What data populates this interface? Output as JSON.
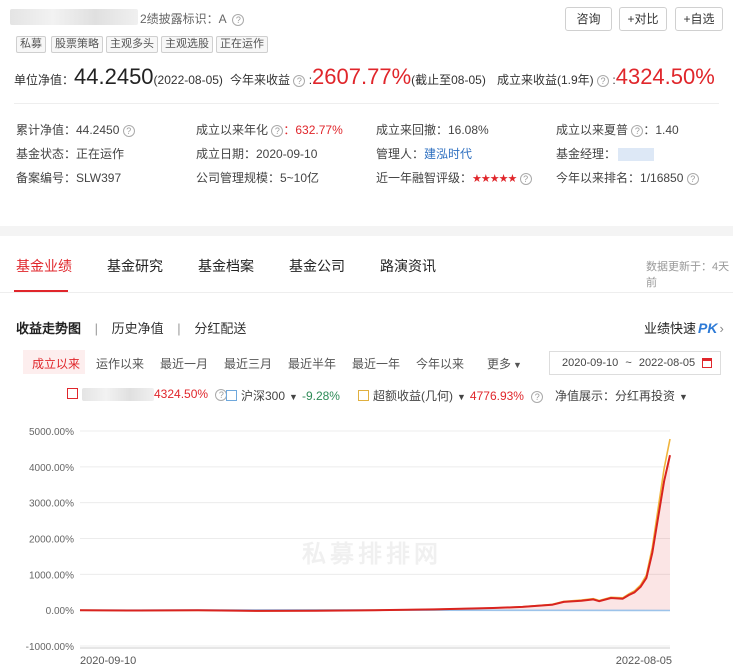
{
  "header": {
    "title_suffix": "2绩披露标识：A",
    "buttons": [
      "咨询",
      "+对比",
      "+自选"
    ],
    "tags": [
      "私募",
      "股票策略",
      "主观多头",
      "主观选股",
      "正在运作"
    ]
  },
  "summary": {
    "nav_label": "单位净值：",
    "nav_value": "44.2450",
    "nav_date": "(2022-08-05)",
    "ytd_label": "今年来收益",
    "ytd_value": "2607.77%",
    "ytd_note": "(截止至08-05)",
    "since_label": "成立来收益(1.9年)",
    "since_value": "4324.50%"
  },
  "info": {
    "cum_nav": "累计净值：44.2450",
    "annual_label": "成立以来年化",
    "annual_value": "：632.77%",
    "drawdown": "成立来回撤：16.08%",
    "sharpe_label": "成立以来夏普",
    "sharpe_value": "：1.40",
    "status": "基金状态：正在运作",
    "inception": "成立日期：2020-09-10",
    "manager_label": "管理人：",
    "manager_value": "建泓时代",
    "fund_manager_label": "基金经理：",
    "reg": "备案编号：SLW397",
    "scale": "公司管理规模：5~10亿",
    "rating_label": "近一年融智评级：",
    "rating_stars": "★★★★★",
    "rank_label": "今年以来排名：",
    "rank_value": "1/16850"
  },
  "tabs": {
    "items": [
      "基金业绩",
      "基金研究",
      "基金档案",
      "基金公司",
      "路演资讯"
    ],
    "update_note": "数据更新于：4天前"
  },
  "subtabs": {
    "items": [
      "收益走势图",
      "历史净值",
      "分红配送"
    ],
    "sep": "|",
    "compare": "业绩快速",
    "pk": "PK"
  },
  "ranges": {
    "items": [
      "成立以来",
      "运作以来",
      "最近一月",
      "最近三月",
      "最近半年",
      "最近一年",
      "今年以来",
      "更多"
    ],
    "date_from": "2020-09-10",
    "date_sep": "~",
    "date_to": "2022-08-05"
  },
  "legend": {
    "fund_value": "4324.50%",
    "index_name": "沪深300",
    "index_value": "-9.28%",
    "excess_name": "超额收益(几何)",
    "excess_value": "4776.93%",
    "display_label": "净值展示：分红再投资"
  },
  "colors": {
    "red": "#e0262b",
    "fund_line": "#d9231f",
    "index_line": "#9cc3ea",
    "excess_line": "#f0b43c"
  },
  "watermark": "私募排排网",
  "chart_data": {
    "type": "line",
    "x_start": "2020-09-10",
    "x_end": "2022-08-05",
    "x_tick_labels": [
      "2020-09-10",
      "2022-08-05"
    ],
    "ylim": [
      -1000,
      5000
    ],
    "y_ticks": [
      "5000.00%",
      "4000.00%",
      "3000.00%",
      "2000.00%",
      "1000.00%",
      "0.00%",
      "-1000.00%"
    ],
    "y_tick_values": [
      5000,
      4000,
      3000,
      2000,
      1000,
      0,
      -1000
    ],
    "series": [
      {
        "name": "",
        "color": "#d9231f",
        "x": [
          0,
          0.1,
          0.2,
          0.3,
          0.4,
          0.5,
          0.6,
          0.7,
          0.75,
          0.8,
          0.82,
          0.85,
          0.87,
          0.88,
          0.9,
          0.92,
          0.93,
          0.94,
          0.95,
          0.96,
          0.97,
          0.98,
          0.99,
          1.0
        ],
        "values": [
          0,
          -10,
          -5,
          -20,
          -15,
          0,
          20,
          60,
          90,
          150,
          230,
          260,
          300,
          250,
          340,
          320,
          420,
          500,
          650,
          900,
          1600,
          2600,
          3600,
          4324.5
        ]
      },
      {
        "name": "沪深300",
        "color": "#9cc3ea",
        "x": [
          0,
          0.2,
          0.4,
          0.6,
          0.8,
          1.0
        ],
        "values": [
          0,
          5,
          10,
          0,
          -5,
          -9.28
        ]
      },
      {
        "name": "超额收益(几何)",
        "color": "#f0b43c",
        "x": [
          0,
          0.1,
          0.2,
          0.3,
          0.4,
          0.5,
          0.6,
          0.7,
          0.75,
          0.8,
          0.82,
          0.85,
          0.87,
          0.88,
          0.9,
          0.92,
          0.93,
          0.94,
          0.95,
          0.96,
          0.97,
          0.98,
          0.99,
          1.0
        ],
        "values": [
          0,
          -10,
          -5,
          -20,
          -15,
          0,
          20,
          60,
          95,
          160,
          245,
          280,
          320,
          270,
          360,
          345,
          450,
          540,
          700,
          980,
          1750,
          2850,
          3950,
          4776.93
        ]
      }
    ]
  }
}
